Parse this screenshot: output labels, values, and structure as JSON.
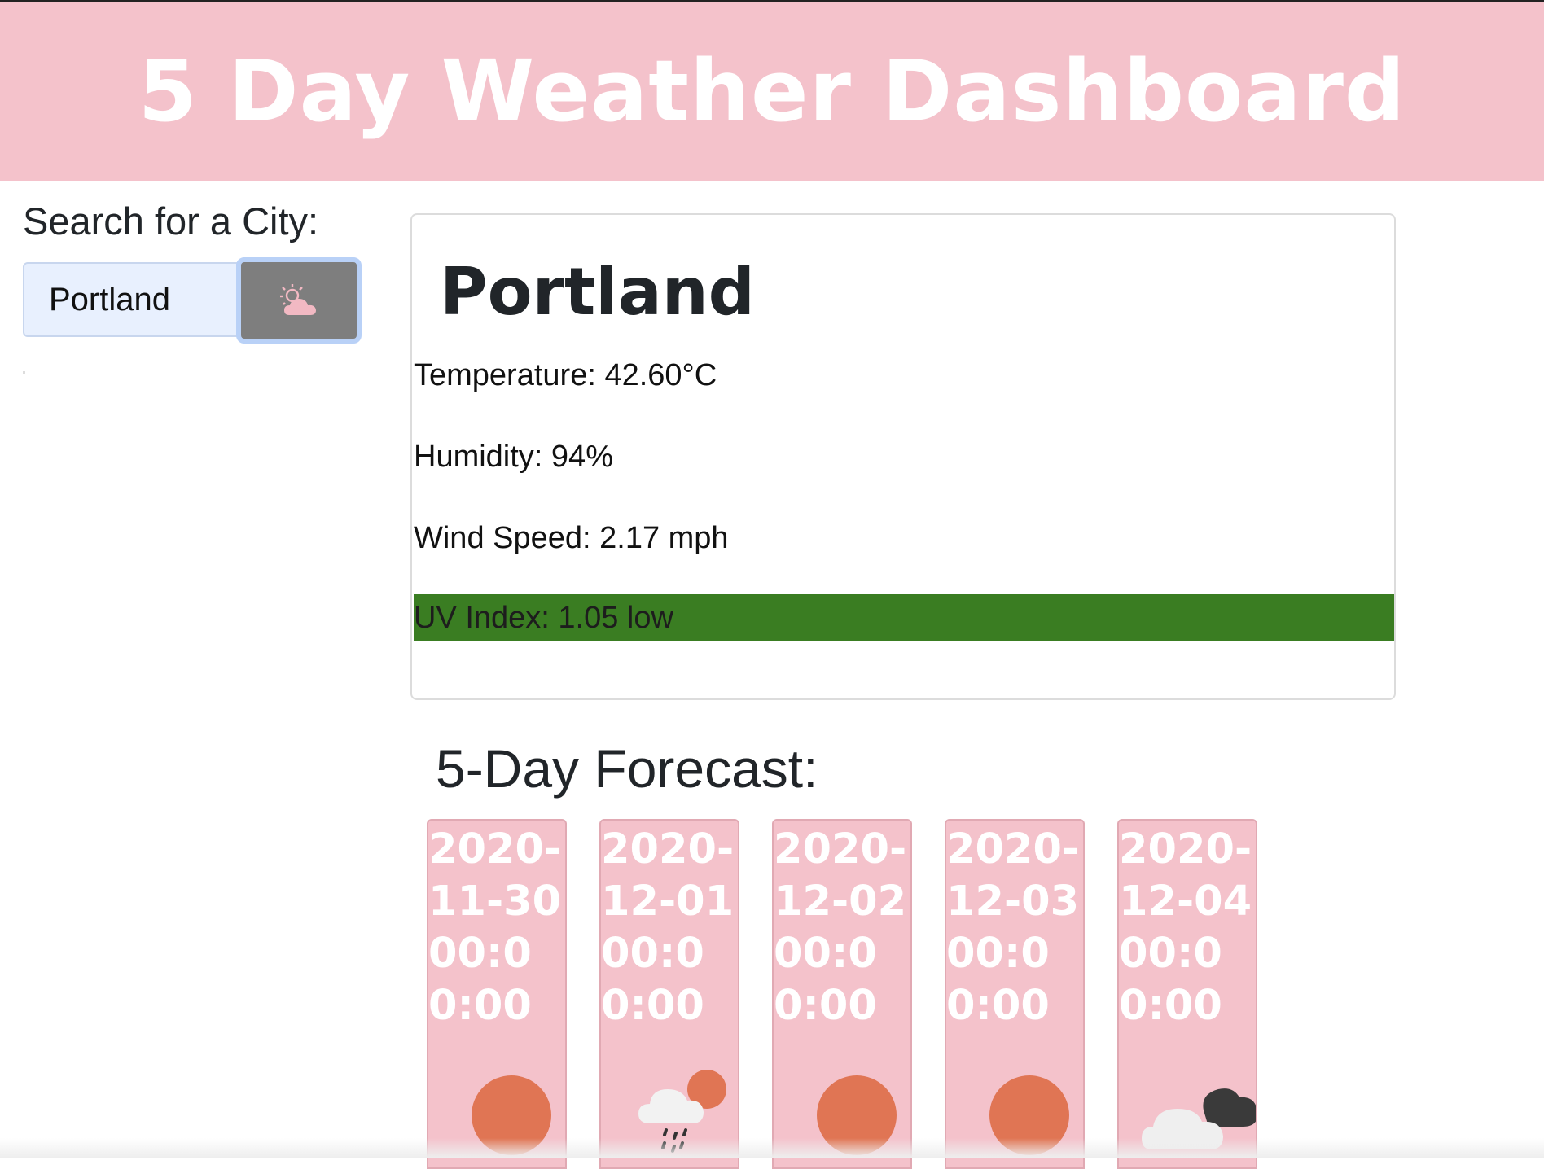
{
  "header": {
    "title": "5 Day Weather Dashboard"
  },
  "search": {
    "heading": "Search for a City:",
    "input_value": "Portland",
    "button_icon": "partly-cloudy-icon"
  },
  "current": {
    "city": "Portland",
    "temperature": "Temperature: 42.60°C",
    "humidity": "Humidity: 94%",
    "wind": "Wind Speed: 2.17 mph",
    "uv": "UV Index: 1.05 low",
    "uv_color": "#3a7d22"
  },
  "forecast": {
    "heading": "5-Day Forecast:",
    "days": [
      {
        "date": "2020-11-30 00:00:00",
        "icon": "sun-icon"
      },
      {
        "date": "2020-12-01 00:00:00",
        "icon": "rain-cloud-sun-icon"
      },
      {
        "date": "2020-12-02 00:00:00",
        "icon": "sun-icon"
      },
      {
        "date": "2020-12-03 00:00:00",
        "icon": "sun-icon"
      },
      {
        "date": "2020-12-04 00:00:00",
        "icon": "cloudy-icon"
      }
    ]
  },
  "colors": {
    "header_bg": "#f4c2cb",
    "card_bg": "#f4c2cb",
    "sun": "#e07554",
    "button_bg": "#7e7e7e"
  }
}
